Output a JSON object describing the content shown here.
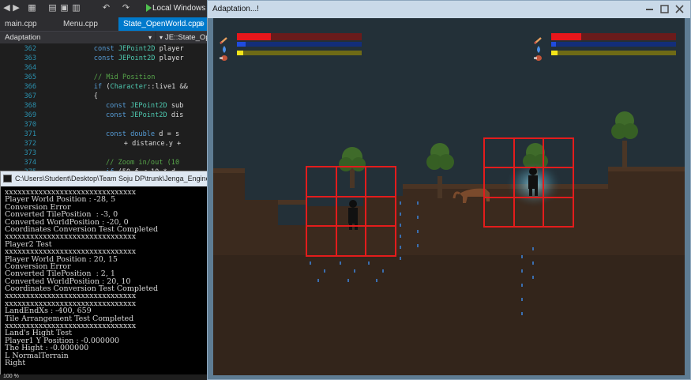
{
  "ide": {
    "toolbar": {
      "icons": [
        "back-icon",
        "forward-icon",
        "new-project-icon",
        "open-file-icon",
        "save-icon",
        "save-all-icon",
        "undo-icon",
        "redo-icon",
        "start-debug-icon"
      ],
      "debug_target": "Local Windows"
    },
    "tabs": [
      {
        "label": "main.cpp",
        "active": false
      },
      {
        "label": "Menu.cpp",
        "active": false
      },
      {
        "label": "State_OpenWorld.cpp",
        "active": true
      }
    ],
    "tab_pin": "⊕",
    "nav": {
      "left": "Adaptation",
      "right": "JE::State_Op"
    },
    "lines": [
      {
        "num": "362",
        "code": "const JEPoint2D player"
      },
      {
        "num": "363",
        "code": "const JEPoint2D player"
      },
      {
        "num": "364",
        "code": ""
      },
      {
        "num": "365",
        "code": "// Mid Position"
      },
      {
        "num": "366",
        "code": "if (Character::live1 &&"
      },
      {
        "num": "367",
        "code": "{"
      },
      {
        "num": "368",
        "code": "const JEPoint2D sub"
      },
      {
        "num": "369",
        "code": "const JEPoint2D dis"
      },
      {
        "num": "370",
        "code": ""
      },
      {
        "num": "371",
        "code": "const double d = s"
      },
      {
        "num": "372",
        "code": "+ distance.y +"
      },
      {
        "num": "373",
        "code": ""
      },
      {
        "num": "374",
        "code": "// Zoom in/out (10"
      },
      {
        "num": "375",
        "code": "if (50.f < 10 * d"
      }
    ]
  },
  "console": {
    "title": "C:\\Users\\Student\\Desktop\\Team Soju DP\\trunk\\Jenga_Engine",
    "lines": [
      "xxxxxxxxxxxxxxxxxxxxxxxxxxxxxxx",
      "Player World Position : -28, 5",
      "Conversion Error",
      "Converted TilePosition  : -3, 0",
      "Converted WorldPosition : -20, 0",
      "Coordinates Conversion Test Completed",
      "xxxxxxxxxxxxxxxxxxxxxxxxxxxxxxx",
      "Player2 Test",
      "xxxxxxxxxxxxxxxxxxxxxxxxxxxxxxx",
      "Player World Position : 20, 15",
      "Conversion Error",
      "Converted TilePosition  : 2, 1",
      "Converted WorldPosition : 20, 10",
      "Coordinates Conversion Test Completed",
      "xxxxxxxxxxxxxxxxxxxxxxxxxxxxxxx",
      "xxxxxxxxxxxxxxxxxxxxxxxxxxxxxxx",
      "LandEndXs : -400, 659",
      "Tile Arrangement Test Completed",
      "xxxxxxxxxxxxxxxxxxxxxxxxxxxxxxx",
      "Land's Hight Test",
      "Player1 Y Position : -0.000000",
      "The Hight : -0.000000",
      "L NormalTerrain",
      "Right"
    ]
  },
  "ide_status": "100 %",
  "game": {
    "window_title": "Adaptation...!",
    "players": [
      {
        "id": "p1",
        "health": 0.27,
        "mana": 0.07,
        "stamina": 0.05,
        "icons": [
          "sword-icon",
          "mana-drop-icon",
          "meat-icon"
        ]
      },
      {
        "id": "p2",
        "health": 0.24,
        "mana": 0.04,
        "stamina": 0.05,
        "icons": [
          "sword-icon",
          "mana-drop-icon",
          "meat-icon"
        ]
      }
    ],
    "colors": {
      "health": "#e8161b",
      "health_bg": "#6a1b1b",
      "mana": "#1f4be0",
      "mana_bg": "#132e7a",
      "stamina": "#f3e41a",
      "stamina_bg": "#6e6a16",
      "grid": "#e31c1c",
      "sky": "#233038",
      "dirt": "#3d2b1f"
    }
  }
}
